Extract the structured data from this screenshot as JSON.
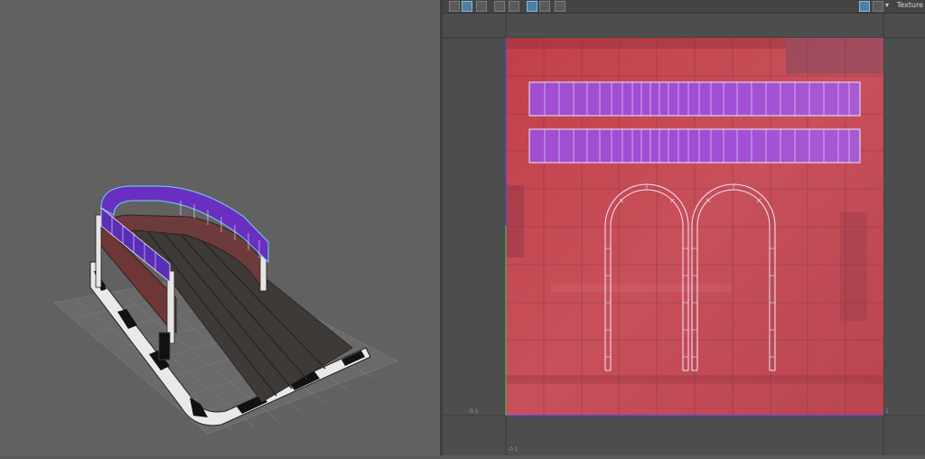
{
  "uv_editor": {
    "toolbar": {
      "buttons": [
        {
          "name": "move-tool-icon",
          "active": false
        },
        {
          "name": "uv-grid-icon",
          "active": true
        },
        {
          "name": "image-display-icon",
          "active": false
        },
        {
          "name": "uv-distort-icon",
          "active": false
        },
        {
          "name": "uv-shell-icon",
          "active": false
        },
        {
          "name": "grid-toggle-icon",
          "active": true
        },
        {
          "name": "pixel-snap-icon",
          "active": false
        },
        {
          "name": "snapshot-icon",
          "active": false
        },
        {
          "name": "texture-image-icon",
          "active": true
        },
        {
          "name": "checker-icon",
          "active": false
        }
      ],
      "texture_label": "Texture"
    },
    "axis_labels": {
      "minus_x": "-0.1",
      "one_x": "1",
      "minus_y": "-0.1"
    }
  },
  "colors": {
    "viewport_bg": "#616161",
    "uv_bg": "#4d4d4d",
    "texture_red": "#c34a55",
    "uv_shell_purple": "#9b4cc9",
    "shell_edge": "#f2e6ff",
    "axis_blue": "#3b4fd9",
    "axis_green": "#3fbf45"
  }
}
